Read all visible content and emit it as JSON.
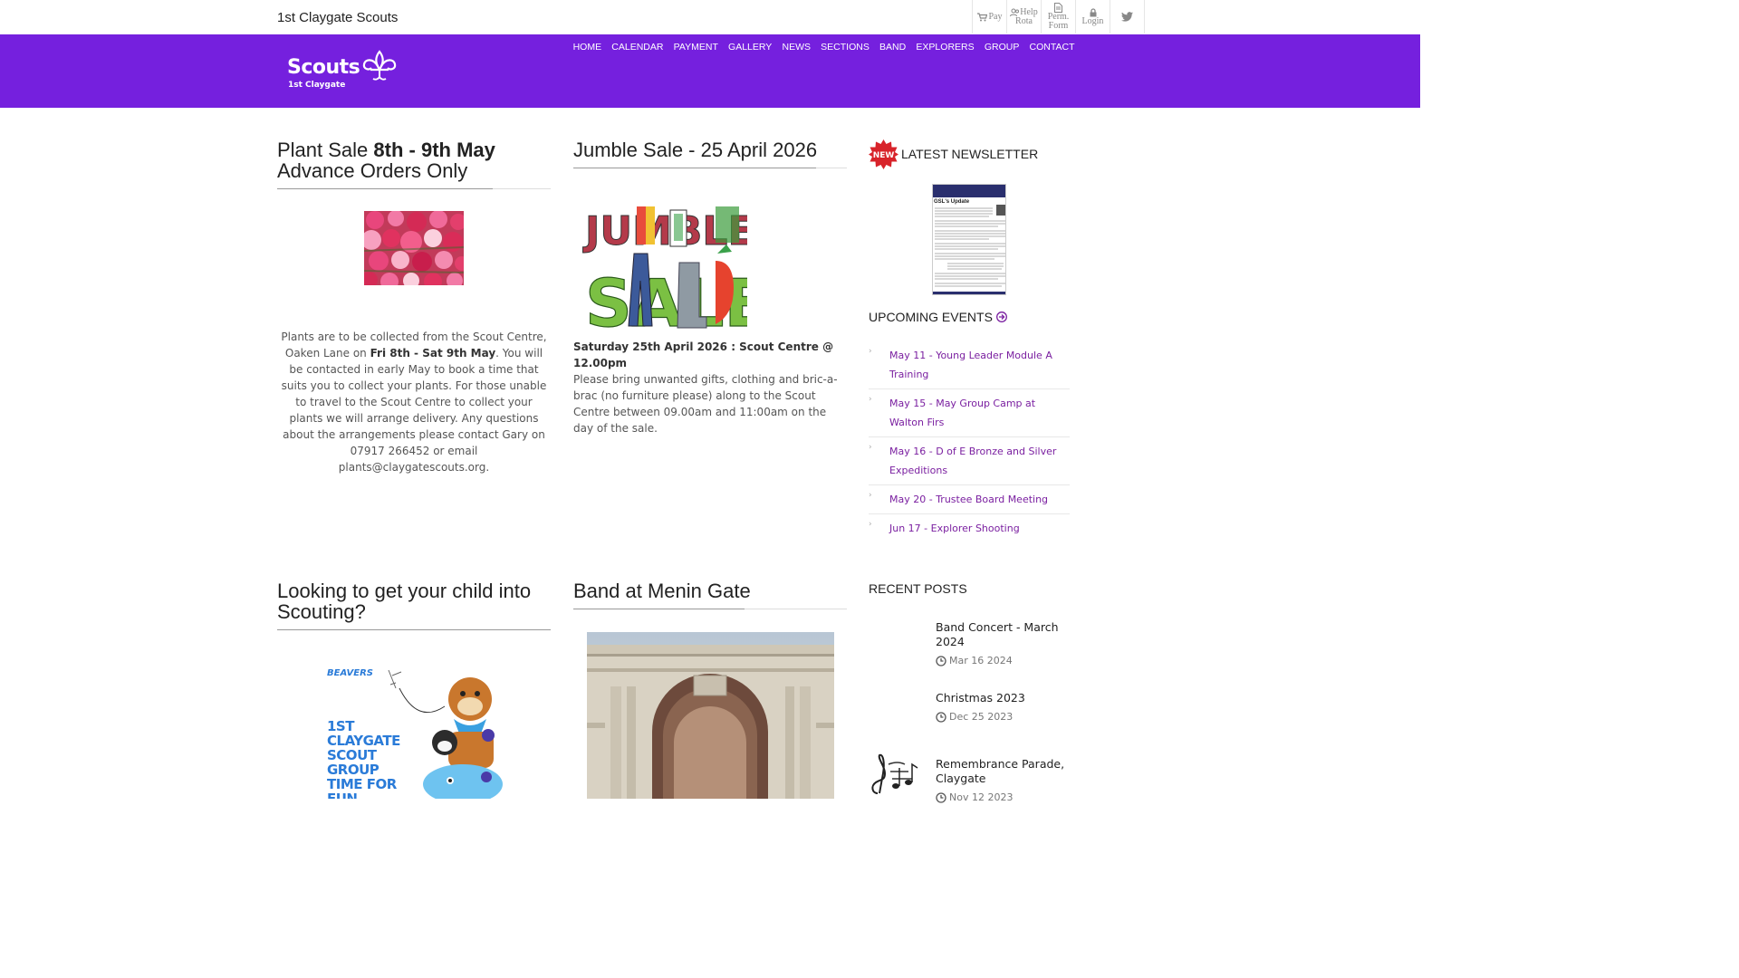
{
  "site": {
    "title": "1st Claygate Scouts"
  },
  "toplinks": {
    "pay": "Pay",
    "help_line1": "Help",
    "help_line2": "Rota",
    "perm_line1": "Perm.",
    "perm_line2": "Form",
    "login": "Login"
  },
  "logo": {
    "word": "Scouts",
    "sub": "1st Claygate"
  },
  "nav": [
    "HOME",
    "CALENDAR",
    "PAYMENT",
    "GALLERY",
    "NEWS",
    "SECTIONS",
    "BAND",
    "EXPLORERS",
    "GROUP",
    "CONTACT"
  ],
  "plant_sale": {
    "title_a": "Plant Sale ",
    "title_b": "8th - 9th May",
    "title_c": "Advance Orders Only",
    "text_1": "Plants are to be collected from the Scout Centre, Oaken Lane on ",
    "text_bold": "Fri 8th - Sat 9th May",
    "text_2": ". You will be contacted in early May to book a time that suits you to collect your plants. For those unable to travel to the Scout Centre to collect your plants we will arrange delivery. Any questions about the arrangements please contact Gary on 07917 266452 or email plants@claygatescouts.org."
  },
  "jumble": {
    "title": "Jumble Sale - 25 April 2026",
    "image_word_1": "JUMBLE",
    "image_word_2": "SALE",
    "date_line": "Saturday 25th April 2026 : Scout Centre @ 12.00pm",
    "text": "Please bring unwanted gifts, clothing and bric-a-brac (no furniture please) along to the Scout Centre between 09.00am and 11:00am on the day of the sale."
  },
  "newsletter": {
    "badge": "NEW",
    "title": "LATEST NEWSLETTER",
    "thumb_heading": "GSL's Update"
  },
  "events": {
    "title": "UPCOMING EVENTS",
    "items": [
      "May 11 - Young Leader Module A Training",
      "May 15 - May Group Camp at Walton Firs",
      "May 16 - D of E Bronze and Silver Expeditions",
      "May 20 - Trustee Board Meeting",
      "Jun 17 - Explorer Shooting"
    ]
  },
  "scouting": {
    "title": "Looking to get your child into Scouting?",
    "poster_tag": "BEAVERS",
    "poster_text": [
      "1ST",
      "CLAYGATE",
      "SCOUT",
      "GROUP",
      "TIME FOR",
      "FUN"
    ]
  },
  "band": {
    "title": "Band at Menin Gate"
  },
  "recent": {
    "title": "RECENT POSTS",
    "posts": [
      {
        "title": "Band Concert - March 2024",
        "date": "Mar 16 2024"
      },
      {
        "title": "Christmas 2023",
        "date": "Dec 25 2023"
      },
      {
        "title": "Remembrance Parade, Claygate",
        "date": "Nov 12 2023"
      }
    ]
  },
  "colors": {
    "header": "#7520de",
    "link": "#7a1fa0"
  }
}
